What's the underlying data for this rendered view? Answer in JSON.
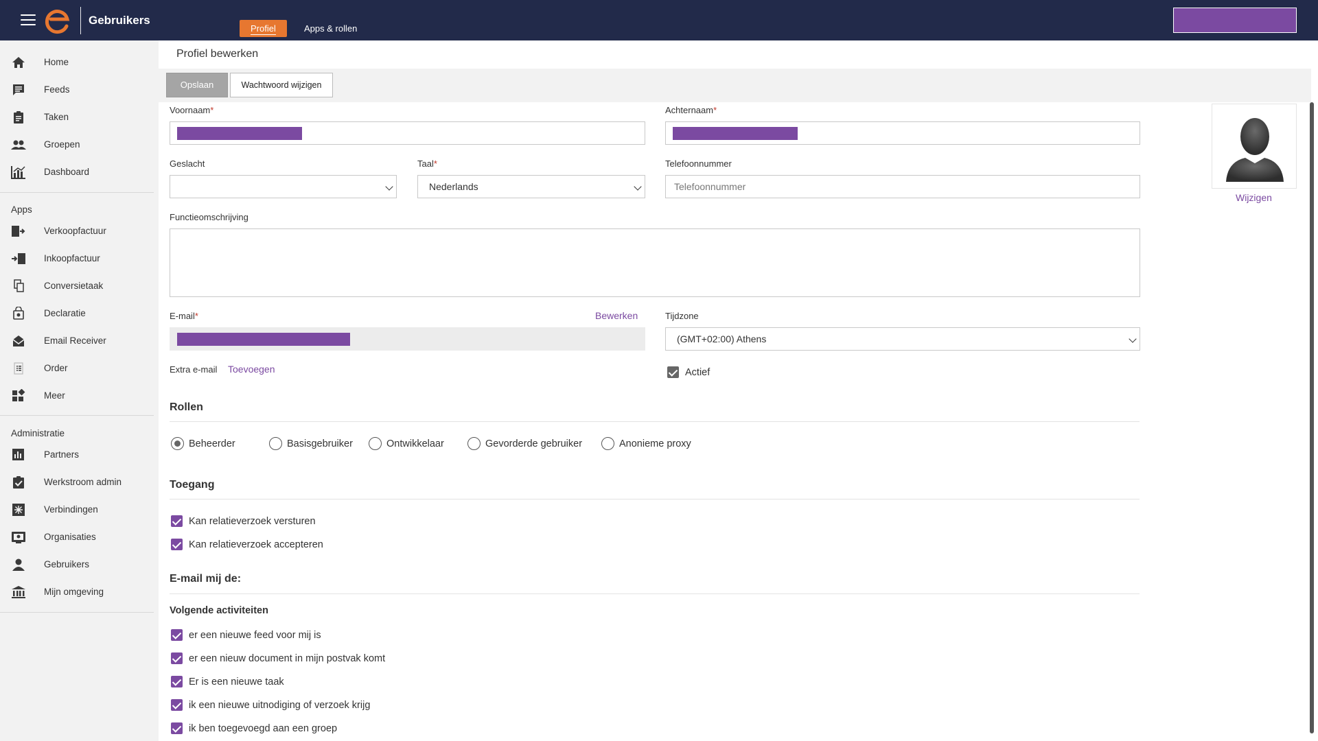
{
  "header": {
    "app_title": "Gebruikers",
    "tabs": [
      {
        "label": "Profiel",
        "active": true
      },
      {
        "label": "Apps & rollen",
        "active": false
      }
    ],
    "accent_color": "#e77730",
    "bar_color": "#222a4a"
  },
  "sidebar": {
    "main_items": [
      {
        "label": "Home",
        "icon": "home-icon"
      },
      {
        "label": "Feeds",
        "icon": "feeds-icon"
      },
      {
        "label": "Taken",
        "icon": "clipboard-icon"
      },
      {
        "label": "Groepen",
        "icon": "people-icon"
      },
      {
        "label": "Dashboard",
        "icon": "chart-icon"
      }
    ],
    "apps_title": "Apps",
    "app_items": [
      {
        "label": "Verkoopfactuur",
        "icon": "sales-invoice-icon"
      },
      {
        "label": "Inkoopfactuur",
        "icon": "purchase-invoice-icon"
      },
      {
        "label": "Conversietaak",
        "icon": "conversion-icon"
      },
      {
        "label": "Declaratie",
        "icon": "expense-icon"
      },
      {
        "label": "Email Receiver",
        "icon": "email-receiver-icon"
      },
      {
        "label": "Order",
        "icon": "order-icon"
      },
      {
        "label": "Meer",
        "icon": "more-apps-icon"
      }
    ],
    "admin_title": "Administratie",
    "admin_items": [
      {
        "label": "Partners",
        "icon": "partners-icon"
      },
      {
        "label": "Werkstroom admin",
        "icon": "workflow-icon"
      },
      {
        "label": "Verbindingen",
        "icon": "connections-icon"
      },
      {
        "label": "Organisaties",
        "icon": "organisations-icon"
      },
      {
        "label": "Gebruikers",
        "icon": "user-icon"
      },
      {
        "label": "Mijn omgeving",
        "icon": "bank-icon"
      }
    ]
  },
  "page": {
    "title": "Profiel bewerken",
    "save_label": "Opslaan",
    "password_label": "Wachtwoord wijzigen"
  },
  "form": {
    "firstname_label": "Voornaam",
    "lastname_label": "Achternaam",
    "gender_label": "Geslacht",
    "gender_value": "",
    "language_label": "Taal",
    "language_value": "Nederlands",
    "phone_label": "Telefoonnummer",
    "phone_placeholder": "Telefoonnummer",
    "function_label": "Functieomschrijving",
    "email_label": "E-mail",
    "email_edit_link": "Bewerken",
    "timezone_label": "Tijdzone",
    "timezone_value": "(GMT+02:00) Athens",
    "extra_email_label": "Extra e-mail",
    "extra_email_link": "Toevoegen",
    "active_label": "Actief",
    "required_mark": "*",
    "avatar_change_link": "Wijzigen"
  },
  "roles": {
    "title": "Rollen",
    "options": [
      {
        "label": "Beheerder",
        "selected": true
      },
      {
        "label": "Basisgebruiker",
        "selected": false
      },
      {
        "label": "Ontwikkelaar",
        "selected": false
      },
      {
        "label": "Gevorderde gebruiker",
        "selected": false
      },
      {
        "label": "Anonieme proxy",
        "selected": false
      }
    ]
  },
  "access": {
    "title": "Toegang",
    "items": [
      {
        "label": "Kan relatieverzoek versturen",
        "checked": true
      },
      {
        "label": "Kan relatieverzoek accepteren",
        "checked": true
      }
    ]
  },
  "email_me": {
    "title": "E-mail mij de:",
    "subtitle": "Volgende activiteiten",
    "items": [
      {
        "label": "er een nieuwe feed voor mij is",
        "checked": true
      },
      {
        "label": "er een nieuw document in mijn postvak komt",
        "checked": true
      },
      {
        "label": "Er is een nieuwe taak",
        "checked": true
      },
      {
        "label": "ik een nieuwe uitnodiging of verzoek krijg",
        "checked": true
      },
      {
        "label": "ik ben toegevoegd aan een groep",
        "checked": true
      }
    ]
  }
}
